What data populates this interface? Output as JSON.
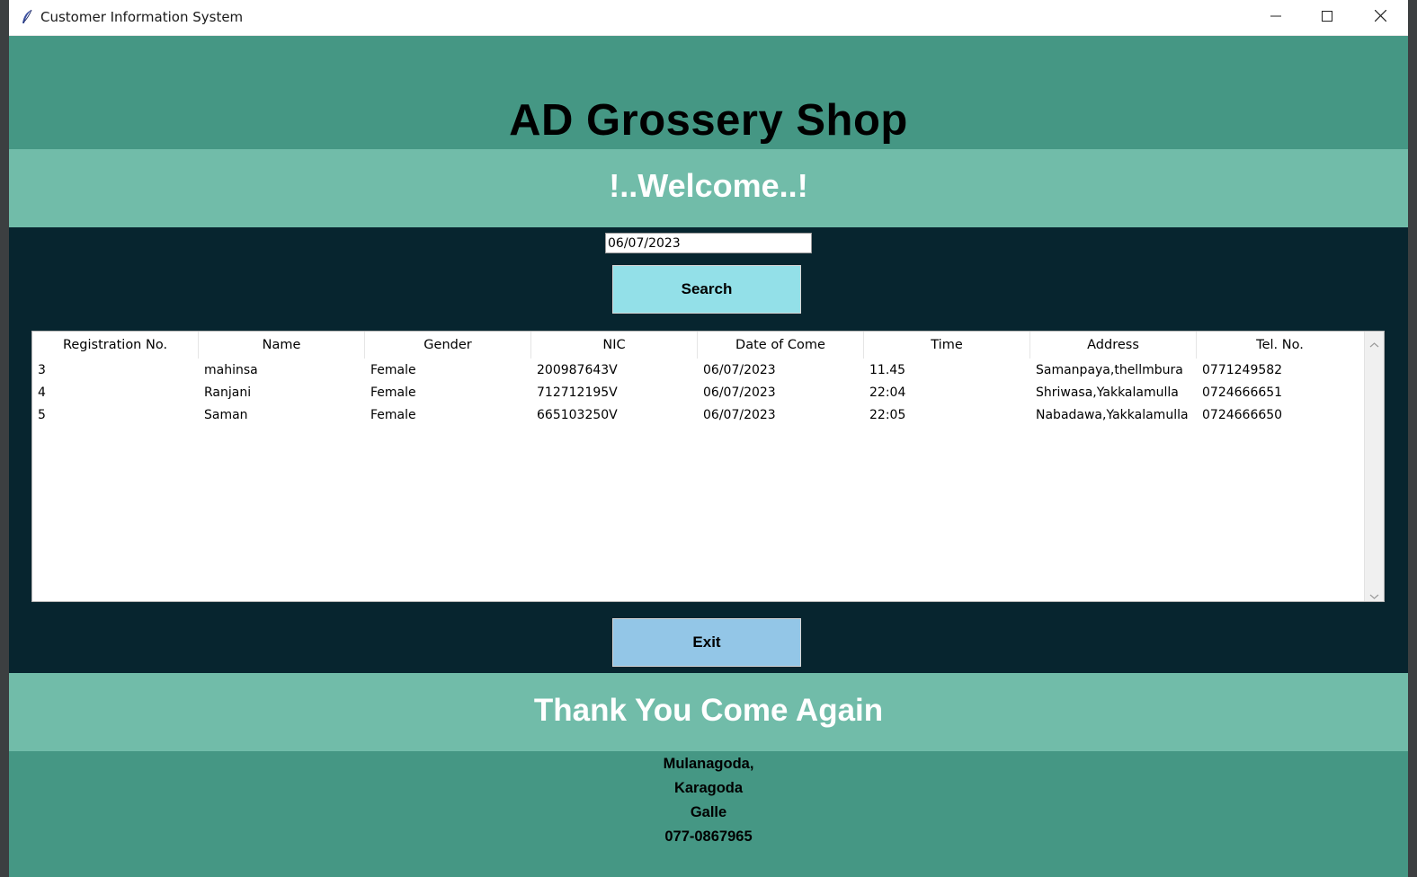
{
  "window": {
    "title": "Customer Information System",
    "icons": {
      "app": "feather-icon",
      "minimize": "minimize-icon",
      "maximize": "maximize-icon",
      "close": "close-icon"
    }
  },
  "header": {
    "shop_name": "AD Grossery Shop"
  },
  "welcome": {
    "text": "!..Welcome..!"
  },
  "search": {
    "value": "06/07/2023",
    "button_label": "Search"
  },
  "table": {
    "columns": [
      "Registration No.",
      "Name",
      "Gender",
      "NIC",
      "Date of Come",
      "Time",
      "Address",
      "Tel. No."
    ],
    "rows": [
      [
        "3",
        "mahinsa",
        "Female",
        "200987643V",
        "06/07/2023",
        "11.45",
        "Samanpaya,thellmbura",
        "0771249582"
      ],
      [
        "4",
        "Ranjani",
        "Female",
        "712712195V",
        "06/07/2023",
        "22:04",
        "Shriwasa,Yakkalamulla",
        "0724666651"
      ],
      [
        "5",
        "Saman",
        "Female",
        "665103250V",
        "06/07/2023",
        "22:05",
        "Nabadawa,Yakkalamulla",
        "0724666650"
      ]
    ]
  },
  "exit": {
    "button_label": "Exit"
  },
  "thanks": {
    "text": "Thank You Come Again"
  },
  "address": {
    "lines": [
      "Mulanagoda,",
      "Karagoda",
      "Galle",
      "077-0867965"
    ]
  },
  "colors": {
    "header_green": "#459784",
    "band_light": "#71bca9",
    "dark_bg": "#07252f",
    "search_button": "#93e0e8",
    "exit_button": "#93c6e7"
  }
}
